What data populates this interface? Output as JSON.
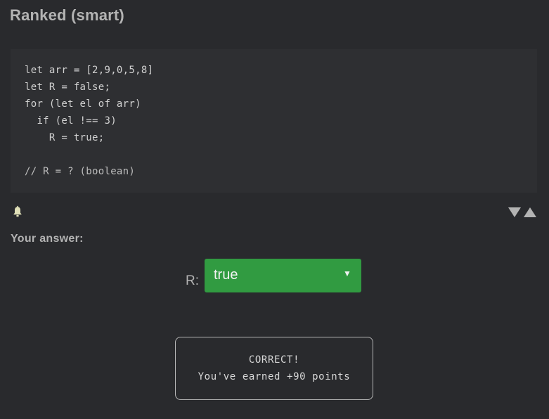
{
  "header": {
    "title": "Ranked (smart)"
  },
  "code": {
    "lines": [
      "let arr = [2,9,0,5,8]",
      "let R = false;",
      "for (let el of arr)",
      "  if (el !== 3)",
      "    R = true;",
      "",
      "// R = ? (boolean)"
    ]
  },
  "toolbar": {
    "bell_icon": "bell-icon",
    "vote_icons": [
      "triangle-down-icon",
      "triangle-up-icon"
    ],
    "icon_color": "#b3b3b3"
  },
  "answer": {
    "label": "Your answer:",
    "variable_label": "R:",
    "selected_value": "true",
    "caret": "▼",
    "select_color": "#319b41"
  },
  "result": {
    "status": "CORRECT!",
    "message": "You've earned +90 points"
  }
}
